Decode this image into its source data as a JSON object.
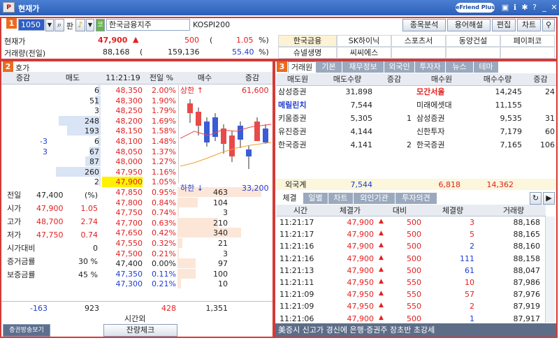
{
  "app": {
    "title": "현재가",
    "logo": "P",
    "brand": "eFriend Plus"
  },
  "toolbar": {
    "code": "1050",
    "mode": "판",
    "stock_name": "한국금융지주",
    "market": "KOSPI200",
    "btns": [
      "종목분석",
      "용어해설",
      "편집",
      "차트"
    ]
  },
  "quote": {
    "cur_label": "현재가",
    "cur_price": "47,900",
    "cur_change": "500",
    "cur_pct": "1.05",
    "pct_unit": "%)",
    "paren": "(",
    "vol_label": "거래량(전일)",
    "vol": "88,168",
    "vol_prev": "159,136",
    "vol_ratio": "55.40",
    "vol_unit": "%)"
  },
  "related": [
    [
      "한국금융",
      "SK하이닉",
      "스포츠서",
      "동양건설",
      "페이퍼코"
    ],
    [
      "슈넬생명",
      "씨씨에스",
      "",
      "",
      ""
    ]
  ],
  "s2": {
    "title": "호가",
    "hdr": [
      "증감",
      "매도",
      "11:21:19",
      "전일 %",
      "매수",
      "증감"
    ],
    "ask": [
      {
        "chg": "",
        "qty": "6",
        "price": "48,350",
        "pct": "2.00%",
        "bar": 4
      },
      {
        "chg": "",
        "qty": "51",
        "price": "48,300",
        "pct": "1.90%",
        "bar": 8
      },
      {
        "chg": "",
        "qty": "3",
        "price": "48,250",
        "pct": "1.79%",
        "bar": 2
      },
      {
        "chg": "",
        "qty": "248",
        "price": "48,200",
        "pct": "1.69%",
        "bar": 60
      },
      {
        "chg": "",
        "qty": "193",
        "price": "48,150",
        "pct": "1.58%",
        "bar": 48
      },
      {
        "chg": "-3",
        "qty": "6",
        "price": "48,100",
        "pct": "1.48%",
        "bar": 4
      },
      {
        "chg": "3",
        "qty": "67",
        "price": "48,050",
        "pct": "1.37%",
        "bar": 16
      },
      {
        "chg": "",
        "qty": "87",
        "price": "48,000",
        "pct": "1.27%",
        "bar": 22
      },
      {
        "chg": "",
        "qty": "260",
        "price": "47,950",
        "pct": "1.16%",
        "bar": 64
      },
      {
        "chg": "",
        "qty": "2",
        "price": "47,900",
        "pct": "1.05%",
        "bar": 2
      }
    ],
    "bid": [
      {
        "price": "47,850",
        "pct": "0.95%",
        "qty": "463",
        "chg": "",
        "bar": 100
      },
      {
        "price": "47,800",
        "pct": "0.84%",
        "qty": "104",
        "chg": "",
        "bar": 24
      },
      {
        "price": "47,750",
        "pct": "0.74%",
        "qty": "3",
        "chg": "",
        "bar": 2
      },
      {
        "price": "47,700",
        "pct": "0.63%",
        "qty": "210",
        "chg": "",
        "bar": 48
      },
      {
        "price": "47,650",
        "pct": "0.42%",
        "qty": "340",
        "chg": "",
        "bar": 76
      },
      {
        "price": "47,550",
        "pct": "0.32%",
        "qty": "21",
        "chg": "",
        "bar": 6
      },
      {
        "price": "47,500",
        "pct": "0.21%",
        "qty": "3",
        "chg": "",
        "bar": 2
      },
      {
        "price": "47,400",
        "pct": "0.00%",
        "qty": "97",
        "chg": "",
        "bar": 22
      },
      {
        "price": "47,350",
        "pct": "0.11%",
        "qty": "100",
        "chg": "",
        "bar": 22
      },
      {
        "price": "47,300",
        "pct": "0.21%",
        "qty": "10",
        "chg": "",
        "bar": 4
      }
    ],
    "info": [
      {
        "l": "전일",
        "v": "47,400",
        "p": "(%)"
      },
      {
        "l": "시가",
        "v": "47,900",
        "p": "1.05"
      },
      {
        "l": "고가",
        "v": "48,700",
        "p": "2.74"
      },
      {
        "l": "저가",
        "v": "47,750",
        "p": "0.74"
      },
      {
        "l": "시가대비",
        "v": "",
        "p": "0"
      },
      {
        "l": "증거금률",
        "v": "",
        "p": "30 %"
      },
      {
        "l": "보증금률",
        "v": "",
        "p": "45 %"
      }
    ],
    "upper": "상한 ↑",
    "upper_v": "61,600",
    "lower": "하한 ↓",
    "lower_v": "33,200",
    "tot": {
      "a": "-163",
      "b": "923",
      "c": "428",
      "d": "1,351"
    },
    "footer": {
      "mid": "시간외",
      "btn": "잔량체크",
      "left": "증권방송보기"
    }
  },
  "s3": {
    "tabs": [
      "거래원",
      "기본",
      "재무정보",
      "외국인",
      "투자자",
      "뉴스",
      "테마"
    ],
    "hdr": [
      "매도원",
      "매도수량",
      "증감",
      "매수원",
      "매수수량",
      "증감"
    ],
    "rows": [
      {
        "s": "삼성증권",
        "sq": "31,898",
        "sc": "",
        "b": "모간서울",
        "bq": "14,245",
        "bc": "24"
      },
      {
        "s": "메릴린치",
        "sq": "7,544",
        "sc": "",
        "b": "미래에셋대",
        "bq": "11,155",
        "bc": ""
      },
      {
        "s": "키움증권",
        "sq": "5,305",
        "sc": "1",
        "b": "삼성증권",
        "bq": "9,535",
        "bc": "31"
      },
      {
        "s": "유진증권",
        "sq": "4,144",
        "sc": "",
        "b": "신한투자",
        "bq": "7,179",
        "bc": "60"
      },
      {
        "s": "한국증권",
        "sq": "4,141",
        "sc": "2",
        "b": "한국증권",
        "bq": "7,165",
        "bc": "106"
      }
    ],
    "foreign": {
      "l": "외국계",
      "v1": "7,544",
      "v2": "6,818",
      "v3": "14,362"
    },
    "tabs2": [
      "체결",
      "일별",
      "차트",
      "외인기관",
      "투자의견"
    ],
    "hdr2": [
      "시간",
      "체결가",
      "대비",
      "체결량",
      "거래량"
    ],
    "ticks": [
      {
        "t": "11:21:17",
        "p": "47,900",
        "d": "500",
        "q": "3",
        "v": "88,168"
      },
      {
        "t": "11:21:17",
        "p": "47,900",
        "d": "500",
        "q": "5",
        "v": "88,165"
      },
      {
        "t": "11:21:16",
        "p": "47,900",
        "d": "500",
        "q": "2",
        "v": "88,160"
      },
      {
        "t": "11:21:16",
        "p": "47,900",
        "d": "500",
        "q": "111",
        "v": "88,158"
      },
      {
        "t": "11:21:13",
        "p": "47,900",
        "d": "500",
        "q": "61",
        "v": "88,047"
      },
      {
        "t": "11:21:11",
        "p": "47,950",
        "d": "550",
        "q": "10",
        "v": "87,986"
      },
      {
        "t": "11:21:09",
        "p": "47,950",
        "d": "550",
        "q": "57",
        "v": "87,976"
      },
      {
        "t": "11:21:09",
        "p": "47,950",
        "d": "550",
        "q": "2",
        "v": "87,919"
      },
      {
        "t": "11:21:06",
        "p": "47,900",
        "d": "500",
        "q": "1",
        "v": "87,917"
      }
    ],
    "news": "美증시 신고가 경신에 은행·증권주 장초반 초강세"
  },
  "colors": {
    "red": "#e32020",
    "blue": "#1f3ccf",
    "accent": "#ec6b1e",
    "border": "#d43a36"
  }
}
